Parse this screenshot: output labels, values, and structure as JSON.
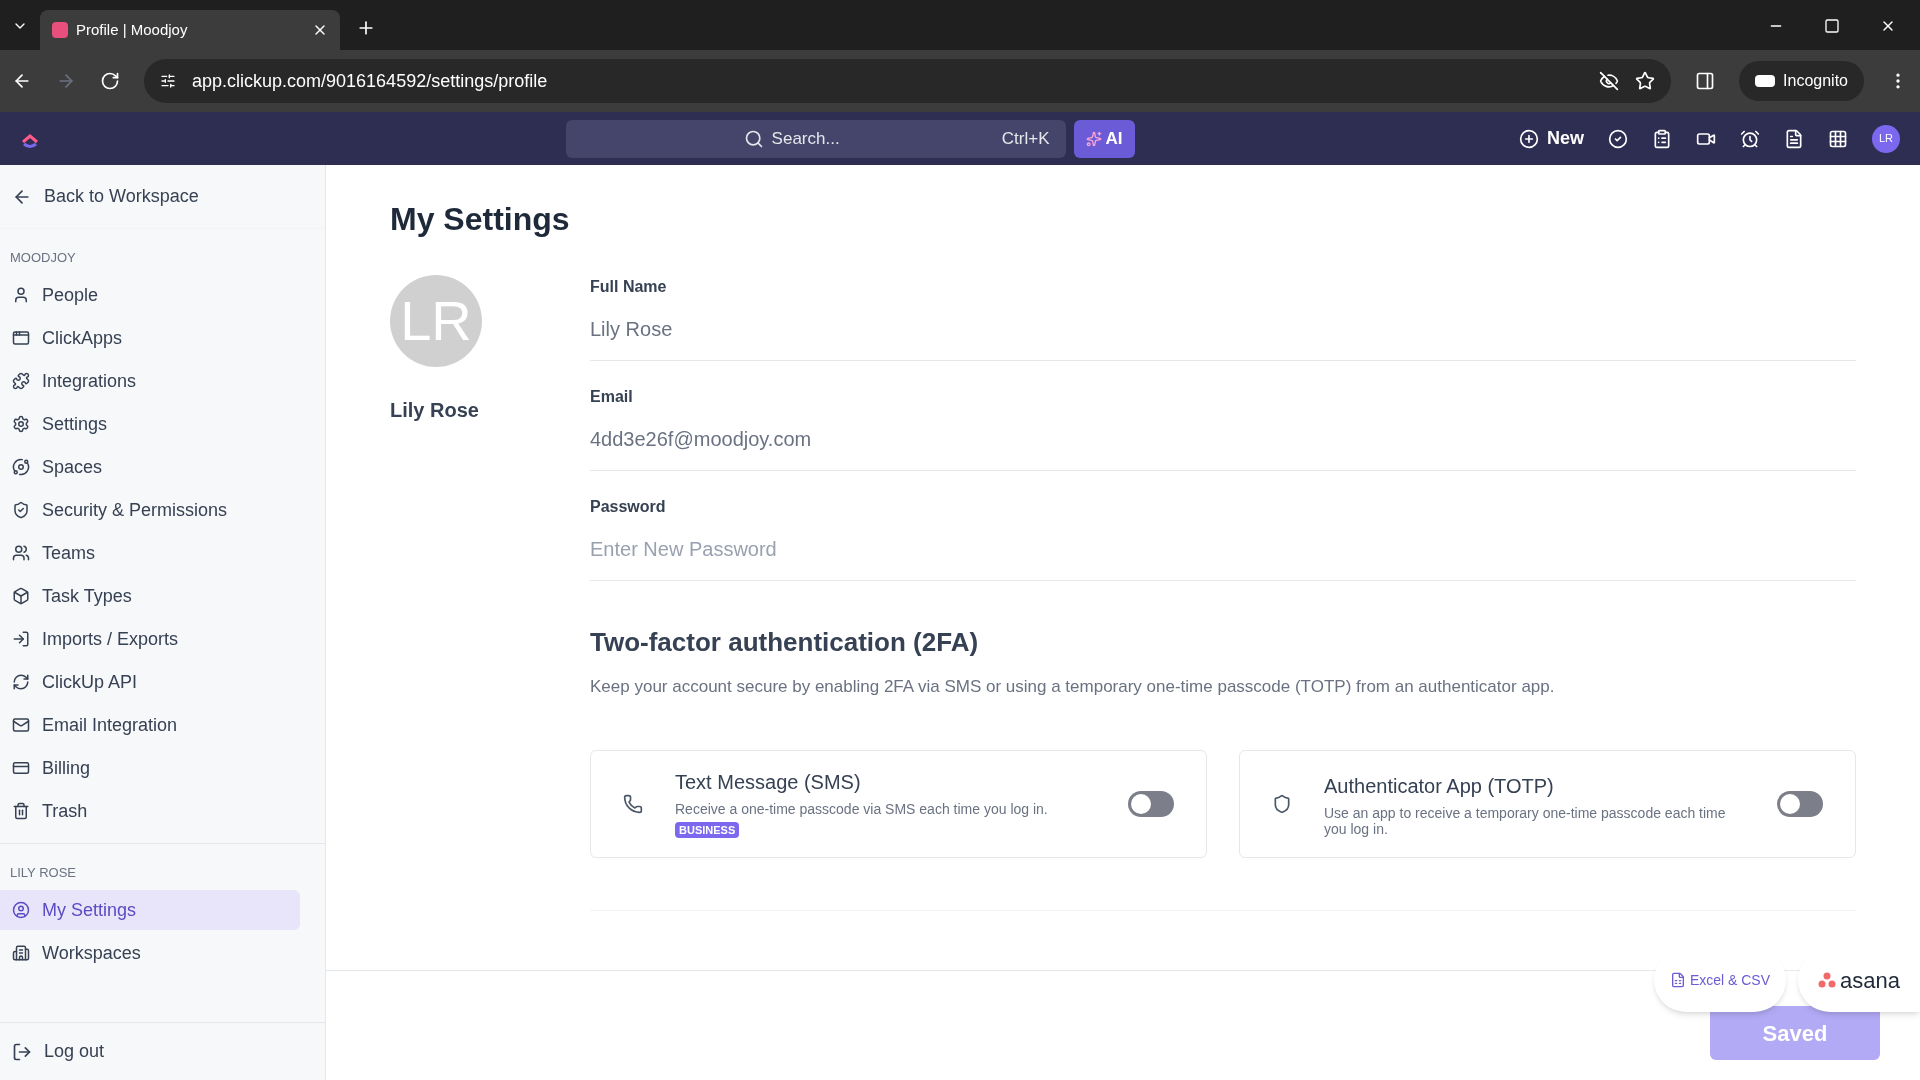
{
  "browser": {
    "tab_title": "Profile | Moodjoy",
    "url": "app.clickup.com/9016164592/settings/profile",
    "incognito_label": "Incognito"
  },
  "app_bar": {
    "search_placeholder": "Search...",
    "search_shortcut": "Ctrl+K",
    "ai_label": "AI",
    "new_label": "New",
    "avatar_initials": "LR"
  },
  "sidebar": {
    "back_label": "Back to Workspace",
    "sections": [
      {
        "title": "MOODJOY",
        "items": [
          {
            "label": "People",
            "selected": false
          },
          {
            "label": "ClickApps",
            "selected": false
          },
          {
            "label": "Integrations",
            "selected": false
          },
          {
            "label": "Settings",
            "selected": false
          },
          {
            "label": "Spaces",
            "selected": false
          },
          {
            "label": "Security & Permissions",
            "selected": false
          },
          {
            "label": "Teams",
            "selected": false
          },
          {
            "label": "Task Types",
            "selected": false
          },
          {
            "label": "Imports / Exports",
            "selected": false
          },
          {
            "label": "ClickUp API",
            "selected": false
          },
          {
            "label": "Email Integration",
            "selected": false
          },
          {
            "label": "Billing",
            "selected": false
          },
          {
            "label": "Trash",
            "selected": false
          }
        ]
      },
      {
        "title": "LILY ROSE",
        "items": [
          {
            "label": "My Settings",
            "selected": true
          },
          {
            "label": "Workspaces",
            "selected": false
          }
        ]
      }
    ],
    "logout_label": "Log out"
  },
  "main": {
    "title": "My Settings",
    "avatar_initials": "LR",
    "profile_name": "Lily Rose",
    "fields": [
      {
        "label": "Full Name",
        "value": "Lily Rose"
      },
      {
        "label": "Email",
        "value": "4dd3e26f@moodjoy.com"
      },
      {
        "label": "Password",
        "placeholder": "Enter New Password"
      }
    ],
    "twofa": {
      "title": "Two-factor authentication (2FA)",
      "description": "Keep your account secure by enabling 2FA via SMS or using a temporary one-time passcode (TOTP) from an authenticator app.",
      "options": [
        {
          "title": "Text Message (SMS)",
          "description": "Receive a one-time passcode via SMS each time you log in.",
          "badge": "BUSINESS",
          "on": false
        },
        {
          "title": "Authenticator App (TOTP)",
          "description": "Use an app to receive a temporary one-time passcode each time you log in.",
          "on": false
        }
      ]
    },
    "overlay_buttons": [
      "Excel & CSV",
      "asana"
    ],
    "save_label": "Saved"
  }
}
